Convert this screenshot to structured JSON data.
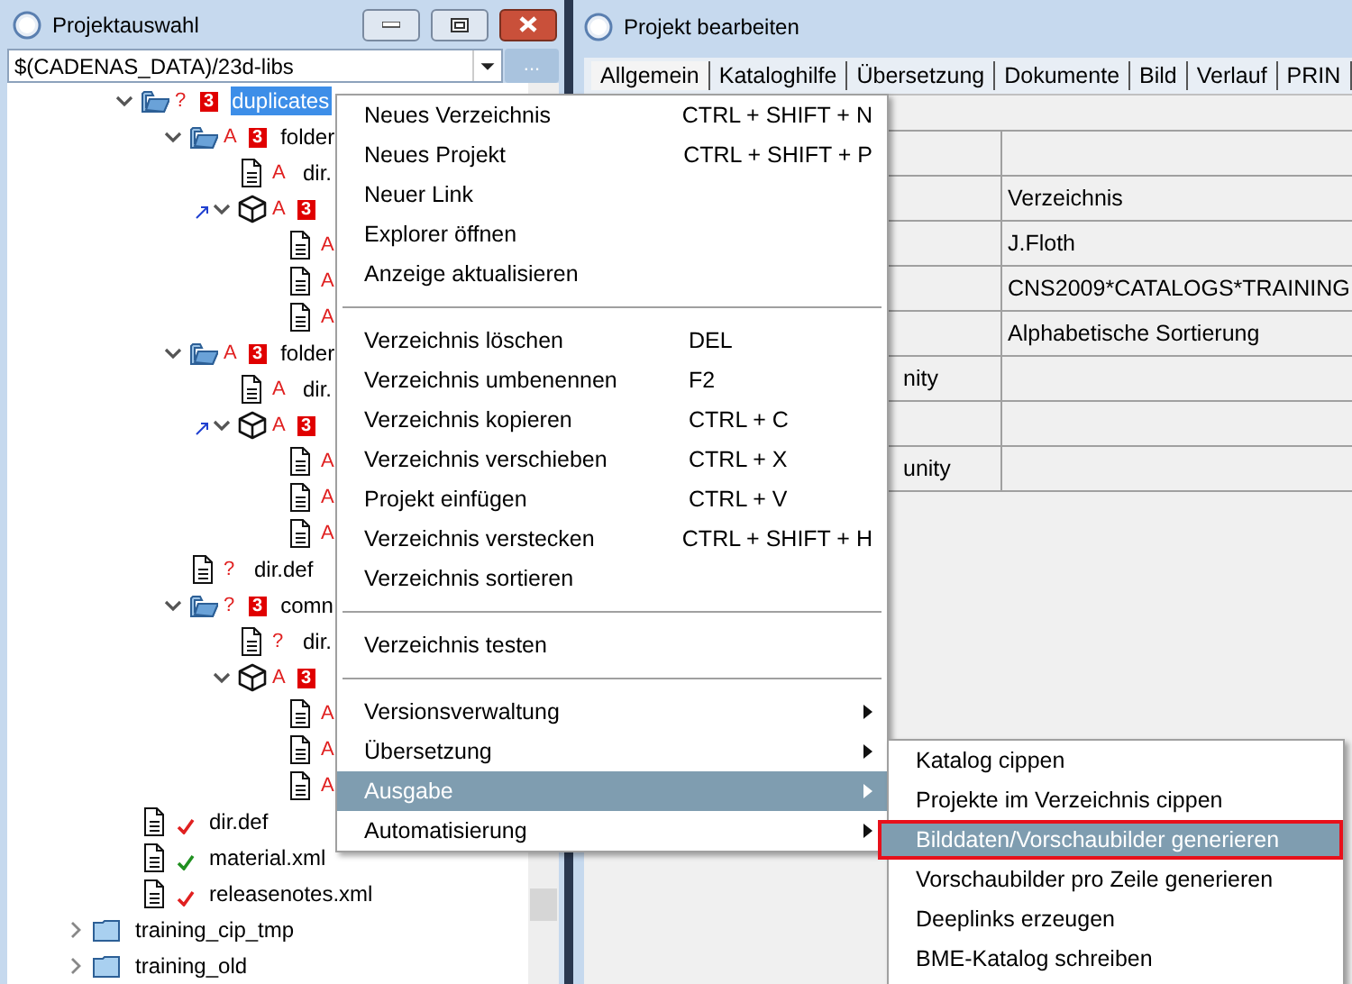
{
  "left_window": {
    "title": "Projektauswahl",
    "path_field": {
      "value": "$(CADENAS_DATA)/23d-libs"
    },
    "browse_button": "...",
    "tree": {
      "continued_items": [
        {
          "kind": "folder_open",
          "flag": "?",
          "badge": "3",
          "label": "duplicates",
          "expanded": true,
          "selected": true,
          "children": [
            {
              "kind": "folder_open",
              "flag": "A",
              "badge": "3",
              "label": "folder",
              "expanded": true,
              "selected": false,
              "children": [
                {
                  "kind": "file",
                  "flag": "A",
                  "label": "dir.",
                  "selected": false
                },
                {
                  "kind": "cube",
                  "flag": "A",
                  "badge": "3",
                  "linked": true,
                  "expanded": true,
                  "children": [
                    {
                      "kind": "file",
                      "flag": "A"
                    },
                    {
                      "kind": "file",
                      "flag": "A"
                    },
                    {
                      "kind": "file",
                      "flag": "A"
                    }
                  ]
                }
              ]
            },
            {
              "kind": "folder_open",
              "flag": "A",
              "badge": "3",
              "label": "folder",
              "expanded": true,
              "selected": false,
              "children": [
                {
                  "kind": "file",
                  "flag": "A",
                  "label": "dir.",
                  "selected": false
                },
                {
                  "kind": "cube",
                  "flag": "A",
                  "badge": "3",
                  "linked": true,
                  "expanded": true,
                  "children": [
                    {
                      "kind": "file",
                      "flag": "A"
                    },
                    {
                      "kind": "file",
                      "flag": "A"
                    },
                    {
                      "kind": "file",
                      "flag": "A"
                    }
                  ]
                }
              ]
            },
            {
              "kind": "file",
              "flag": "?",
              "label": "dir.def",
              "selected": false
            },
            {
              "kind": "folder_open",
              "flag": "?",
              "badge": "3",
              "label": "comn",
              "expanded": true,
              "selected": false,
              "children": [
                {
                  "kind": "file",
                  "flag": "?",
                  "label": "dir.",
                  "selected": false
                },
                {
                  "kind": "cube",
                  "flag": "A",
                  "badge": "3",
                  "expanded": true,
                  "children": [
                    {
                      "kind": "file",
                      "flag": "A"
                    },
                    {
                      "kind": "file",
                      "flag": "A"
                    },
                    {
                      "kind": "file",
                      "flag": "A"
                    }
                  ]
                }
              ]
            }
          ]
        },
        {
          "kind": "file",
          "color": "#e02020",
          "label": "dir.def",
          "selected": false
        },
        {
          "kind": "file",
          "color": "#209020",
          "label": "material.xml",
          "selected": false
        },
        {
          "kind": "file",
          "color": "#e02020",
          "label": "releasenotes.xml",
          "selected": false
        }
      ],
      "items": [
        {
          "kind": "folder",
          "label": "training_cip_tmp",
          "expanded": false,
          "selected": false
        },
        {
          "kind": "folder",
          "label": "training_old",
          "expanded": false,
          "selected": false
        }
      ]
    }
  },
  "right_window": {
    "title": "Projekt bearbeiten",
    "tabs": [
      {
        "label": "Allgemein",
        "selected": true
      },
      {
        "label": "Kataloghilfe",
        "selected": false
      },
      {
        "label": "Übersetzung",
        "selected": false
      },
      {
        "label": "Dokumente",
        "selected": false
      },
      {
        "label": "Bild",
        "selected": false
      },
      {
        "label": "Verlauf",
        "selected": false
      },
      {
        "label": "PRIN",
        "selected": false
      }
    ],
    "table": {
      "rows": [
        {
          "column_2": ""
        },
        {
          "column_2": "Verzeichnis"
        },
        {
          "column_2": "J.Floth"
        },
        {
          "column_2": "CNS2009*CATALOGS*TRAINING"
        },
        {
          "column_2": "Alphabetische Sortierung"
        },
        {
          "column_1": "nity",
          "column_2": ""
        },
        {
          "column_2": ""
        },
        {
          "column_1": "unity",
          "column_2": ""
        }
      ]
    }
  },
  "context_menu": {
    "groups": [
      [
        {
          "label": "Neues Verzeichnis",
          "shortcut": "CTRL + SHIFT + N",
          "selected": false
        },
        {
          "label": "Neues Projekt",
          "shortcut": "CTRL + SHIFT + P",
          "selected": false
        },
        {
          "label": "Neuer Link",
          "selected": false
        },
        {
          "label": "Explorer öffnen",
          "selected": false
        },
        {
          "label": "Anzeige aktualisieren",
          "selected": false
        }
      ],
      [
        {
          "label": "Verzeichnis löschen",
          "shortcut": "DEL",
          "selected": false
        },
        {
          "label": "Verzeichnis umbenennen",
          "shortcut": "F2",
          "selected": false
        },
        {
          "label": "Verzeichnis kopieren",
          "shortcut": "CTRL + C",
          "selected": false
        },
        {
          "label": "Verzeichnis verschieben",
          "shortcut": "CTRL + X",
          "selected": false
        },
        {
          "label": "Projekt einfügen",
          "shortcut": "CTRL + V",
          "selected": false
        },
        {
          "label": "Verzeichnis verstecken",
          "shortcut": "CTRL + SHIFT + H",
          "selected": false
        },
        {
          "label": "Verzeichnis sortieren",
          "selected": false
        }
      ],
      [
        {
          "label": "Verzeichnis testen",
          "selected": false
        }
      ],
      [
        {
          "label": "Versionsverwaltung",
          "submenu": true,
          "selected": false
        },
        {
          "label": "Übersetzung",
          "submenu": true,
          "selected": false
        },
        {
          "label": "Ausgabe",
          "submenu": true,
          "selected": true
        },
        {
          "label": "Automatisierung",
          "submenu": true,
          "selected": false
        }
      ]
    ]
  },
  "submenu": {
    "items": [
      {
        "label": "Katalog cippen",
        "selected": false,
        "outlined": false
      },
      {
        "label": "Projekte im Verzeichnis cippen",
        "selected": false,
        "outlined": false
      },
      {
        "label": "Bilddaten/Vorschaubilder generieren",
        "selected": true,
        "outlined": true
      },
      {
        "label": "Vorschaubilder pro Zeile generieren",
        "selected": false,
        "outlined": false
      },
      {
        "label": "Deeplinks erzeugen",
        "selected": false,
        "outlined": false
      },
      {
        "label": "BME-Katalog schreiben",
        "selected": false,
        "outlined": false
      }
    ]
  }
}
